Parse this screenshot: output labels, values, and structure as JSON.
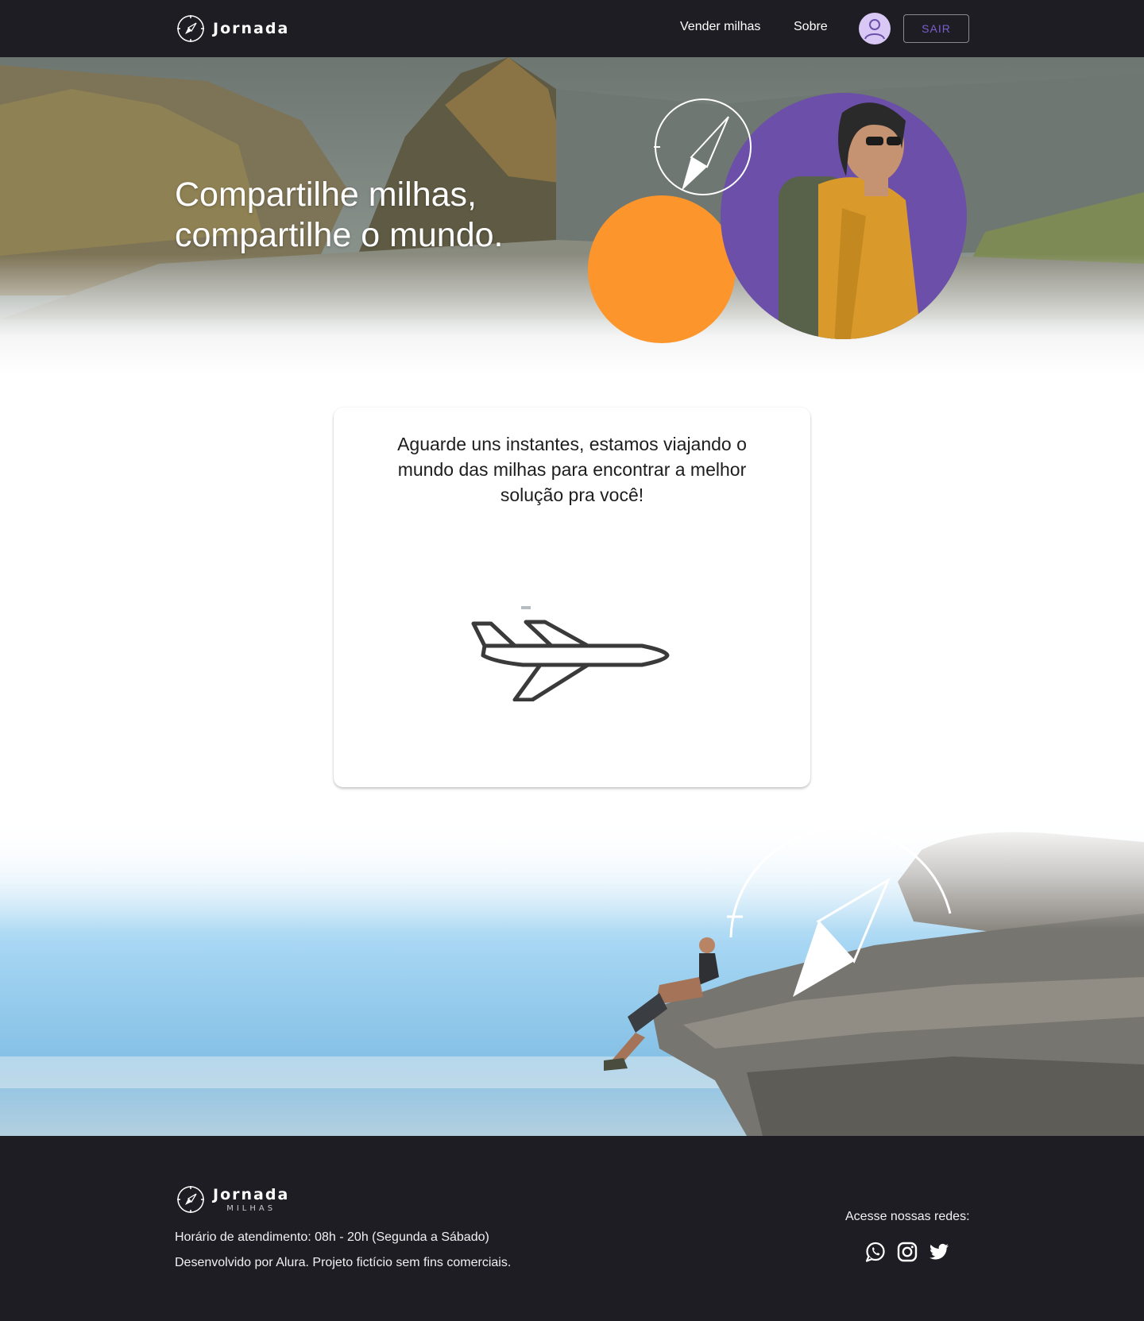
{
  "header": {
    "brand": "Jornada",
    "nav": {
      "sell_miles": "Vender milhas",
      "about": "Sobre"
    },
    "logout_label": "SAIR"
  },
  "hero": {
    "title_line1": "Compartilhe milhas,",
    "title_line2": "compartilhe o mundo."
  },
  "loading": {
    "message": "Aguarde uns instantes, estamos viajando o mundo das milhas para encontrar a melhor solução pra você!",
    "icon": "airplane-icon"
  },
  "footer": {
    "brand": "Jornada",
    "brand_sub": "MILHAS",
    "hours": "Horário de atendimento: 08h - 20h (Segunda a Sábado)",
    "credits": "Desenvolvido por Alura. Projeto fictício sem fins comerciais.",
    "social_title": "Acesse nossas redes:",
    "social": [
      "whatsapp-icon",
      "instagram-icon",
      "twitter-icon"
    ]
  },
  "colors": {
    "dark": "#1e1d23",
    "accent_orange": "#fb952c",
    "accent_purple": "#6b4fa8",
    "button_text": "#7a5fd0"
  }
}
